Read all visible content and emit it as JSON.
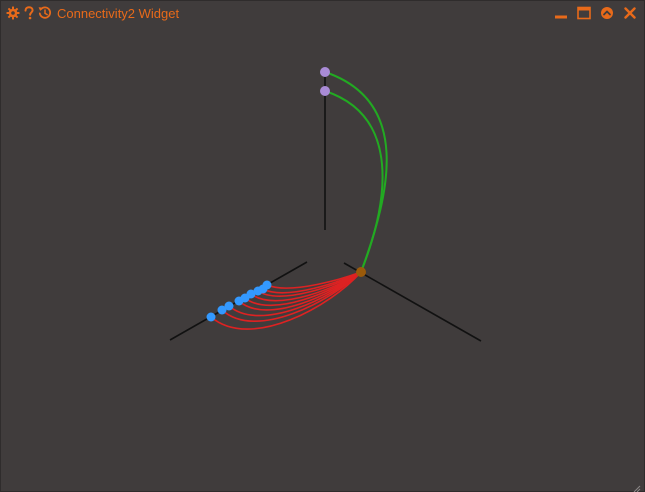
{
  "window": {
    "title": "Connectivity2 Widget",
    "accent_color": "#e86a1a",
    "background_color": "#403c3c"
  },
  "titlebar": {
    "left_icons": [
      "gear-icon",
      "help-icon",
      "reset-icon"
    ],
    "right_icons": [
      "minimize-icon",
      "maximize-icon",
      "collapse-icon",
      "close-icon"
    ]
  },
  "scene": {
    "axis_color": "#111111",
    "source_node_color": "#9a5a0a",
    "lower_target_color": "#3399ff",
    "upper_target_color": "#a98bd6",
    "lower_connection_color": "#dd2222",
    "upper_connection_color": "#22aa22",
    "lower_target_count": 9,
    "upper_target_count": 2
  }
}
